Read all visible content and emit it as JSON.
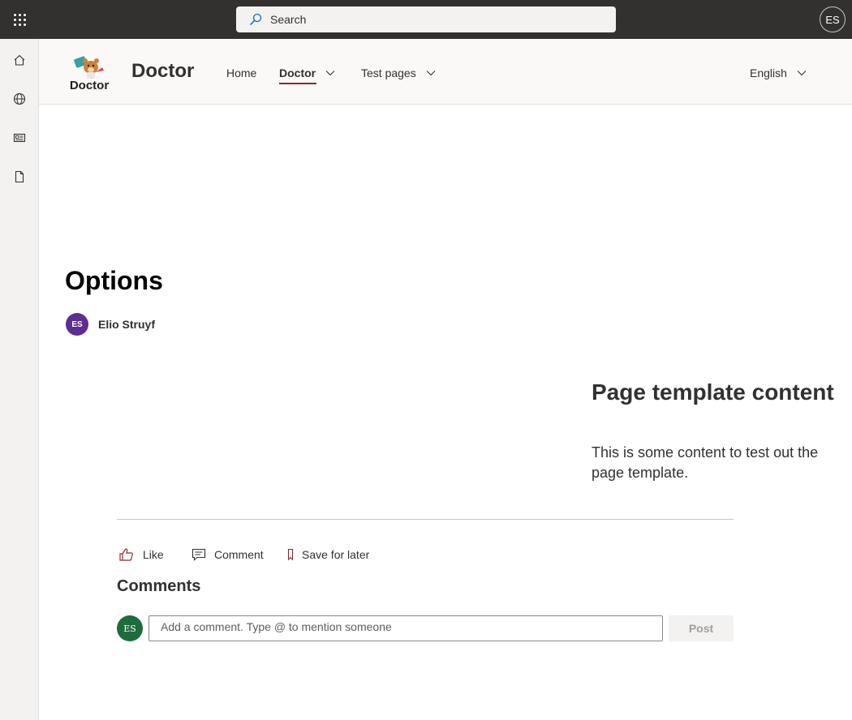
{
  "suitebar": {
    "search_placeholder": "Search",
    "me_initials": "ES"
  },
  "appbar": {
    "items": [
      {
        "icon": "home-icon"
      },
      {
        "icon": "globe-icon"
      },
      {
        "icon": "news-icon"
      },
      {
        "icon": "document-icon"
      }
    ]
  },
  "header": {
    "logo_text": "Doctor",
    "site_title": "Doctor",
    "nav": [
      {
        "label": "Home"
      },
      {
        "label": "Doctor",
        "active": true
      },
      {
        "label": "Test pages"
      }
    ],
    "language": "English"
  },
  "page": {
    "title": "Options",
    "author_initials": "ES",
    "author_name": "Elio Struyf"
  },
  "template": {
    "heading": "Page template content",
    "text": "This is some content to test out the page template."
  },
  "actions": {
    "like": "Like",
    "comment": "Comment",
    "save": "Save for later"
  },
  "comments": {
    "title": "Comments",
    "commenter_initials": "ES",
    "input_placeholder": "Add a comment. Type @ to mention someone",
    "post": "Post"
  },
  "colors": {
    "suitebar": "#323130",
    "accent": "#8a2c2c",
    "author_avatar": "#5c2e91",
    "commenter_avatar": "#1e6b3c"
  }
}
